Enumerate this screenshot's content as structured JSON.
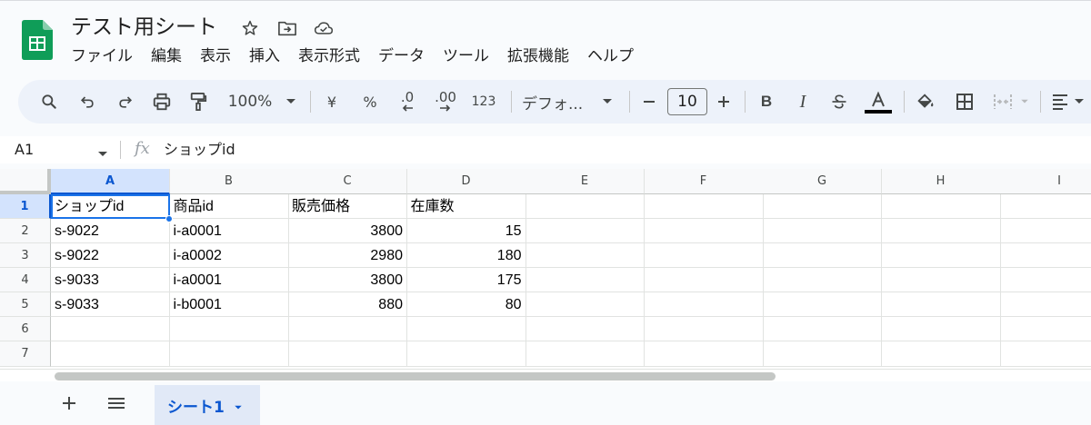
{
  "doc": {
    "title": "テスト用シート"
  },
  "menu": [
    "ファイル",
    "編集",
    "表示",
    "挿入",
    "表示形式",
    "データ",
    "ツール",
    "拡張機能",
    "ヘルプ"
  ],
  "toolbar": {
    "zoom": "100%",
    "currency": "¥",
    "percent": "%",
    "decrease_decimal": ".0",
    "increase_decimal": ".00",
    "more_formats": "123",
    "font": "デフォ...",
    "font_size": "10",
    "bold": "B",
    "italic": "I",
    "text_color_accent": "#000000"
  },
  "formula_bar": {
    "cell_ref": "A1",
    "fx": "fx",
    "value": "ショップid"
  },
  "columns": [
    "A",
    "B",
    "C",
    "D",
    "E",
    "F",
    "G",
    "H",
    "I"
  ],
  "rows": [
    "1",
    "2",
    "3",
    "4",
    "5",
    "6",
    "7"
  ],
  "table": [
    [
      "ショップid",
      "商品id",
      "販売価格",
      "在庫数"
    ],
    [
      "s-9022",
      "i-a0001",
      "3800",
      "15"
    ],
    [
      "s-9022",
      "i-a0002",
      "2980",
      "180"
    ],
    [
      "s-9033",
      "i-a0001",
      "3800",
      "175"
    ],
    [
      "s-9033",
      "i-b0001",
      "880",
      "80"
    ]
  ],
  "sheets": [
    {
      "label": "シート1",
      "active": true
    }
  ],
  "colors": {
    "accent": "#0b57d0",
    "selection": "#1a73e8",
    "logo": "#0f9d58"
  }
}
